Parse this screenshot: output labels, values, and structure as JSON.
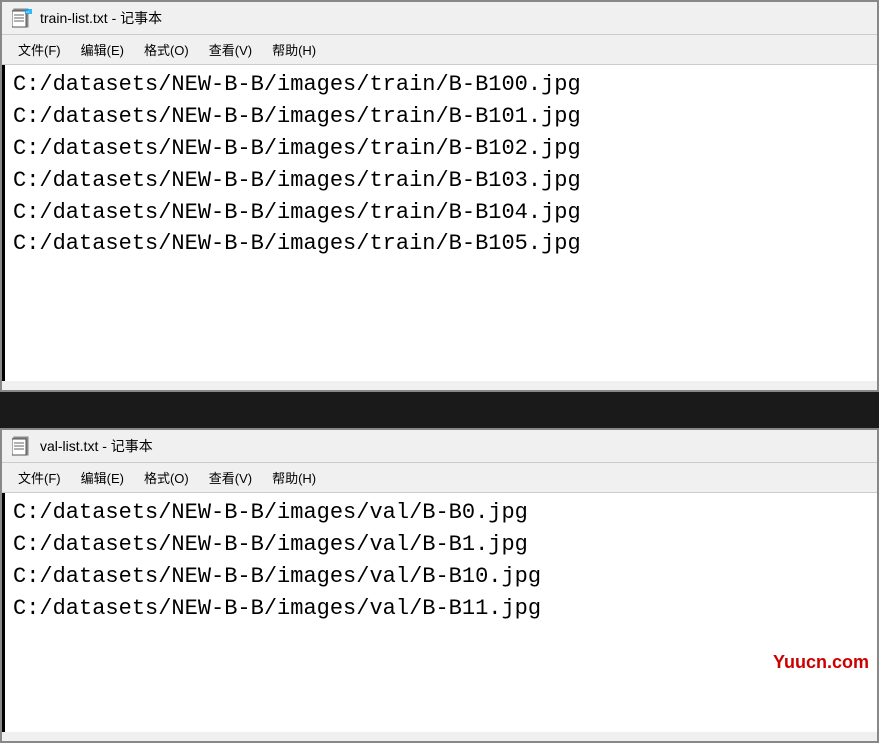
{
  "window1": {
    "title": "train-list.txt - 记事本",
    "icon": "📄",
    "menu": [
      "文件(F)",
      "编辑(E)",
      "格式(O)",
      "查看(V)",
      "帮助(H)"
    ],
    "lines": [
      "C:/datasets/NEW-B-B/images/train/B-B100.jpg",
      "C:/datasets/NEW-B-B/images/train/B-B101.jpg",
      "C:/datasets/NEW-B-B/images/train/B-B102.jpg",
      "C:/datasets/NEW-B-B/images/train/B-B103.jpg",
      "C:/datasets/NEW-B-B/images/train/B-B104.jpg",
      "C:/datasets/NEW-B-B/images/train/B-B105.jpg"
    ]
  },
  "window2": {
    "title": "val-list.txt - 记事本",
    "icon": "📄",
    "menu": [
      "文件(F)",
      "编辑(E)",
      "格式(O)",
      "查看(V)",
      "帮助(H)"
    ],
    "lines": [
      "C:/datasets/NEW-B-B/images/val/B-B0.jpg",
      "C:/datasets/NEW-B-B/images/val/B-B1.jpg",
      "C:/datasets/NEW-B-B/images/val/B-B10.jpg",
      "C:/datasets/NEW-B-B/images/val/B-B11.jpg"
    ]
  },
  "watermark": "Yuucn.com",
  "menu_items": {
    "file": "文件(F)",
    "edit": "编辑(E)",
    "format": "格式(O)",
    "view": "查看(V)",
    "help": "帮助(H)"
  }
}
